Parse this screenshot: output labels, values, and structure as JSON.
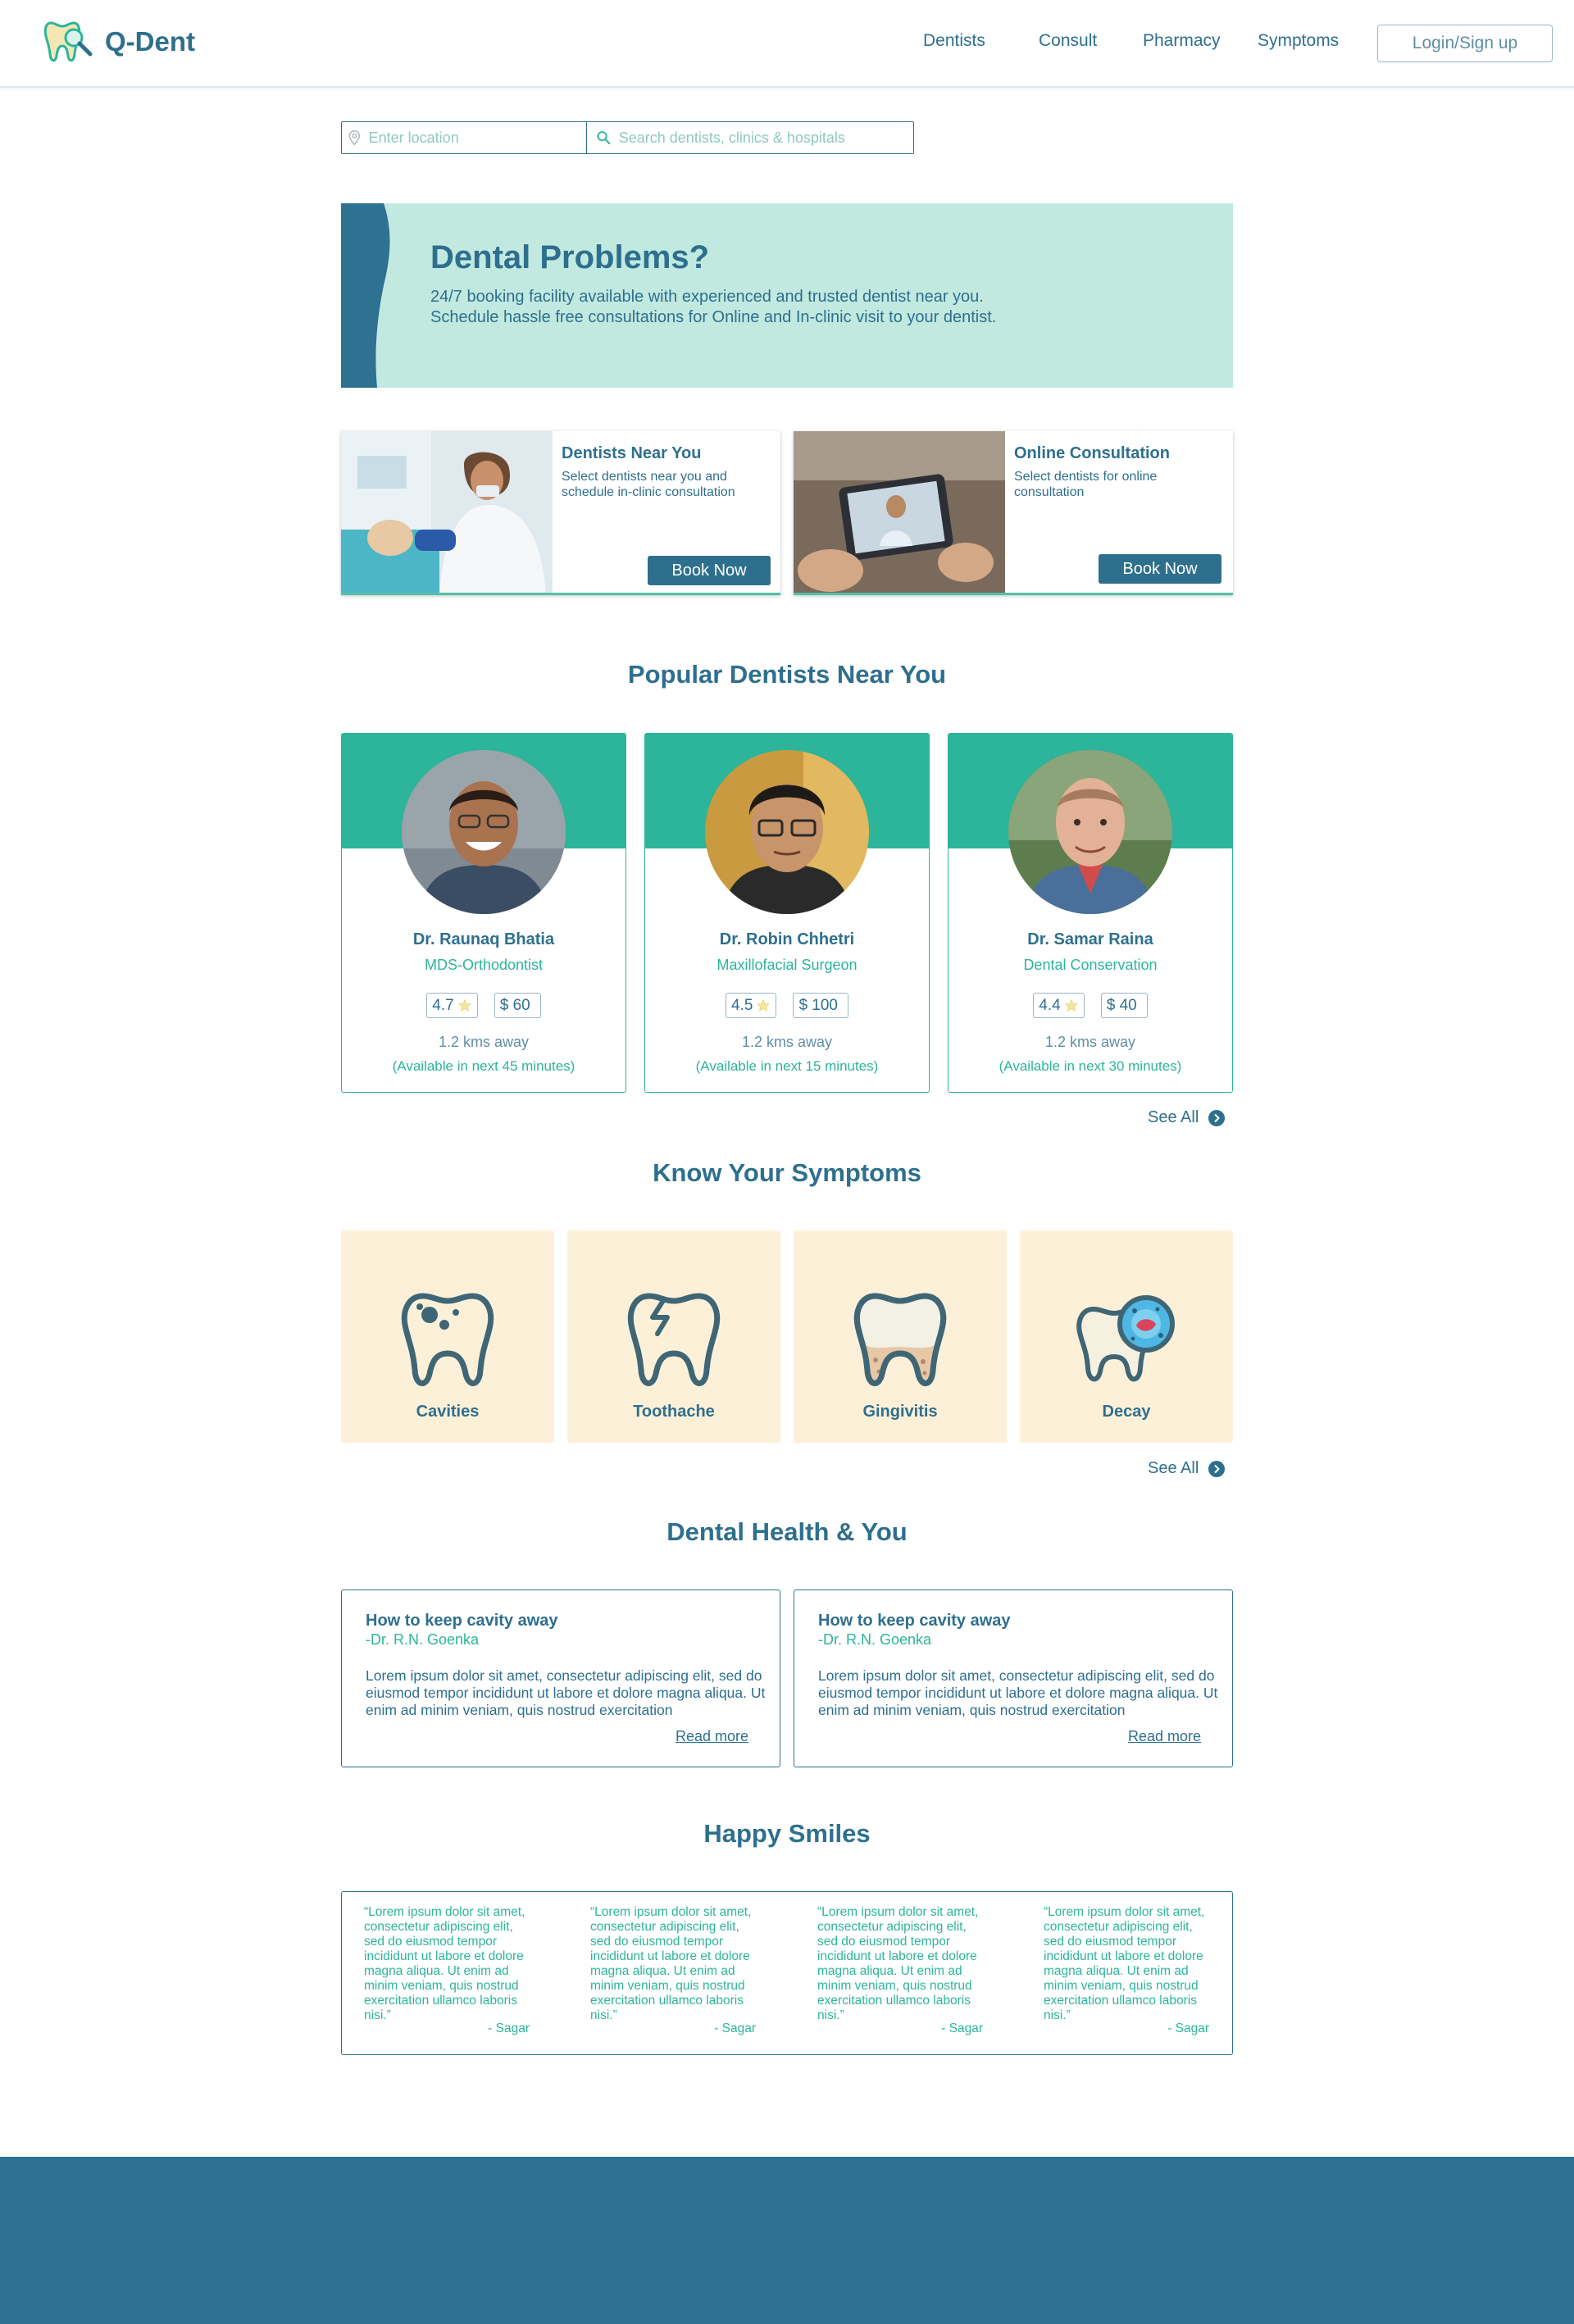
{
  "brand": {
    "name": "Q-Dent"
  },
  "nav": {
    "items": [
      "Dentists",
      "Consult",
      "Pharmacy",
      "Symptoms"
    ],
    "login": "Login/Sign up"
  },
  "search": {
    "location_placeholder": "Enter location",
    "query_placeholder": "Search dentists, clinics & hospitals"
  },
  "hero": {
    "title": "Dental Problems?",
    "text": "24/7 booking facility available with experienced and trusted dentist near you. Schedule hassle free consultations for Online and In-clinic visit to your dentist."
  },
  "services": [
    {
      "title": "Dentists Near You",
      "desc": "Select dentists near you and schedule in-clinic consultation",
      "button": "Book Now"
    },
    {
      "title": "Online Consultation",
      "desc": "Select dentists for online consultation",
      "button": "Book Now"
    }
  ],
  "popular": {
    "title": "Popular Dentists Near You",
    "see_all": "See All",
    "dentists": [
      {
        "name": "Dr. Raunaq Bhatia",
        "spec": "MDS-Orthodontist",
        "rating": "4.7",
        "fee": "$ 60",
        "distance": "1.2 kms away",
        "avail": "(Available in next 45 minutes)"
      },
      {
        "name": "Dr. Robin Chhetri",
        "spec": "Maxillofacial Surgeon",
        "rating": "4.5",
        "fee": "$ 100",
        "distance": "1.2 kms away",
        "avail": "(Available in next 15 minutes)"
      },
      {
        "name": "Dr. Samar Raina",
        "spec": "Dental Conservation",
        "rating": "4.4",
        "fee": "$ 40",
        "distance": "1.2 kms away",
        "avail": "(Available in next 30 minutes)"
      }
    ]
  },
  "symptoms": {
    "title": "Know Your Symptoms",
    "see_all": "See All",
    "items": [
      "Cavities",
      "Toothache",
      "Gingivitis",
      "Decay"
    ]
  },
  "health": {
    "title": "Dental Health & You",
    "articles": [
      {
        "title": "How to keep cavity away",
        "author": "-Dr. R.N. Goenka",
        "body": "Lorem ipsum dolor sit amet, consectetur adipiscing elit, sed do eiusmod tempor incididunt ut labore et dolore magna aliqua. Ut enim ad minim veniam, quis nostrud exercitation",
        "more": "Read more"
      },
      {
        "title": "How to keep cavity away",
        "author": "-Dr. R.N. Goenka",
        "body": "Lorem ipsum dolor sit amet, consectetur adipiscing elit, sed do eiusmod tempor incididunt ut labore et dolore magna aliqua. Ut enim ad minim veniam, quis nostrud exercitation",
        "more": "Read more"
      }
    ]
  },
  "smiles": {
    "title": "Happy Smiles",
    "quotes": [
      {
        "text": "“Lorem ipsum dolor sit amet, consectetur adipiscing elit, sed do eiusmod tempor incididunt ut labore et dolore magna aliqua. Ut enim ad minim veniam, quis nostrud exercitation ullamco laboris nisi.”",
        "by": "- Sagar"
      },
      {
        "text": "“Lorem ipsum dolor sit amet, consectetur adipiscing elit, sed do eiusmod tempor incididunt ut labore et dolore magna aliqua. Ut enim ad minim veniam, quis nostrud exercitation ullamco laboris nisi.”",
        "by": "- Sagar"
      },
      {
        "text": "“Lorem ipsum dolor sit amet, consectetur adipiscing elit, sed do eiusmod tempor incididunt ut labore et dolore magna aliqua. Ut enim ad minim veniam, quis nostrud exercitation ullamco laboris nisi.”",
        "by": "- Sagar"
      },
      {
        "text": "“Lorem ipsum dolor sit amet, consectetur adipiscing elit, sed do eiusmod tempor incididunt ut labore et dolore magna aliqua. Ut enim ad minim veniam, quis nostrud exercitation ullamco laboris nisi.”",
        "by": "- Sagar"
      }
    ]
  },
  "colors": {
    "primary": "#2e6f8e",
    "accent": "#2cb59a",
    "hero_bg": "#c1e9e0",
    "symptom_bg": "#fdf0d8",
    "footer": "#2e7190"
  },
  "icons": {
    "logo": "tooth-magnifier-icon",
    "location": "location-pin-icon",
    "search": "search-icon",
    "star": "star-icon",
    "chevron": "chevron-right-icon"
  }
}
